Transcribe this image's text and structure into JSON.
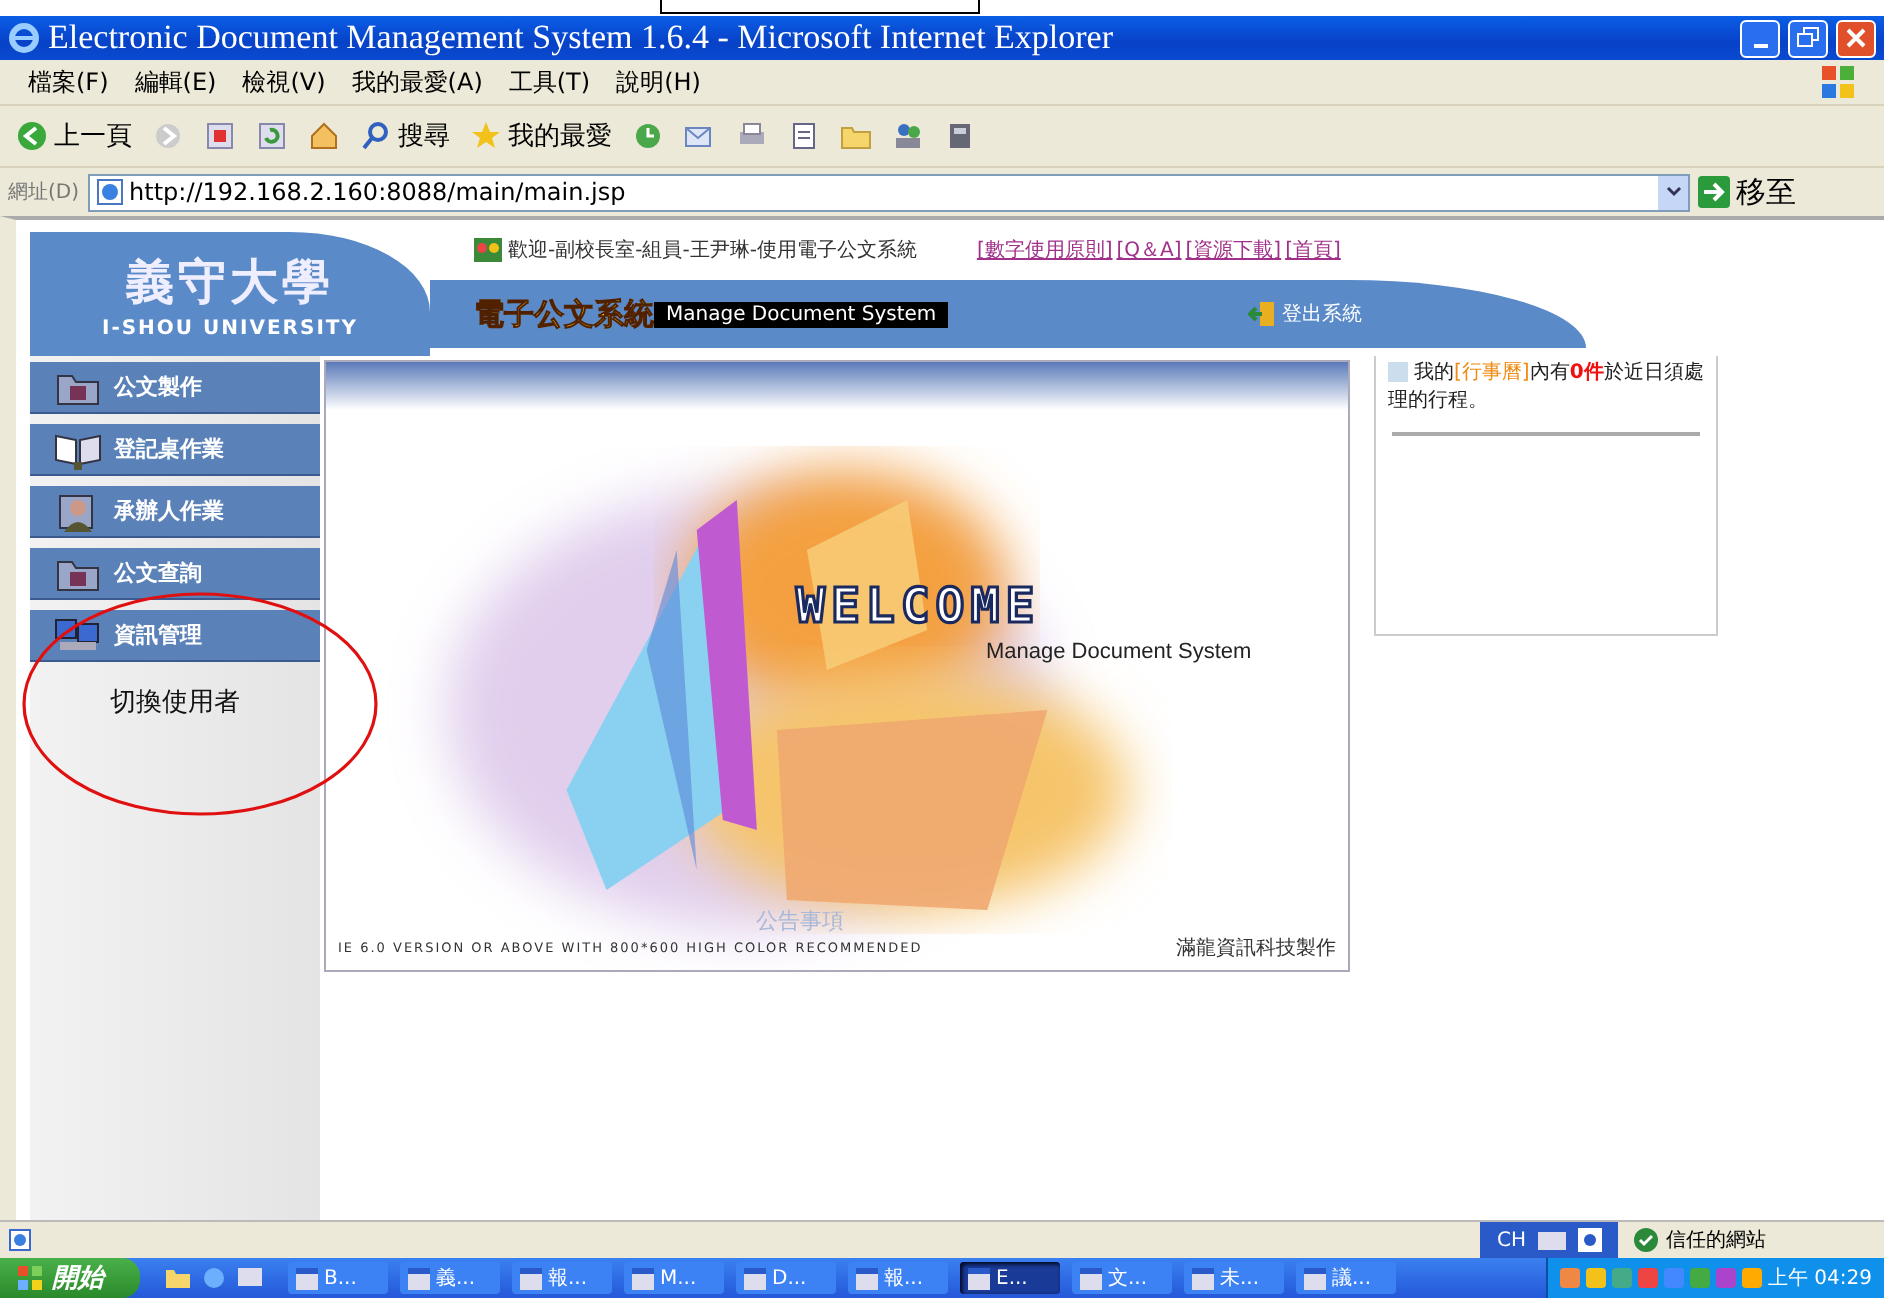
{
  "window": {
    "title": "Electronic Document Management System 1.6.4 - Microsoft Internet Explorer"
  },
  "menu": [
    "檔案(F)",
    "編輯(E)",
    "檢視(V)",
    "我的最愛(A)",
    "工具(T)",
    "說明(H)"
  ],
  "toolbar": [
    {
      "kind": "back",
      "label": "上一頁"
    },
    {
      "kind": "forward"
    },
    {
      "kind": "stop"
    },
    {
      "kind": "refresh"
    },
    {
      "kind": "home"
    },
    {
      "kind": "search",
      "label": "搜尋"
    },
    {
      "kind": "favorites",
      "label": "我的最愛"
    },
    {
      "kind": "history"
    },
    {
      "kind": "mail"
    },
    {
      "kind": "print"
    },
    {
      "kind": "edit"
    },
    {
      "kind": "folder"
    },
    {
      "kind": "messenger"
    },
    {
      "kind": "notes"
    }
  ],
  "address": {
    "label": "網址(D)",
    "value": "http://192.168.2.160:8088/main/main.jsp",
    "go": "移至"
  },
  "header": {
    "school": "義守大學",
    "school_en": "I-SHOU UNIVERSITY",
    "welcome": "歡迎-副校長室-組員-王尹琳-使用電子公文系統",
    "links": [
      "[數字使用原則]",
      "[Q＆A]",
      "[資源下載]",
      "[首頁]"
    ],
    "system_name": "電子公文系統",
    "system_en": "Manage Document System",
    "logout": "登出系統"
  },
  "sidebar": {
    "items": [
      {
        "label": "公文製作",
        "kind": "folder"
      },
      {
        "label": "登記桌作業",
        "kind": "book"
      },
      {
        "label": "承辦人作業",
        "kind": "person"
      },
      {
        "label": "公文查詢",
        "kind": "folder"
      },
      {
        "label": "資訊管理",
        "kind": "computers"
      }
    ],
    "submenu": [
      "切換使用者"
    ]
  },
  "main": {
    "welcome": "WELCOME",
    "subtitle": "Manage Document System",
    "news": "公告事項",
    "footer_note": "IE 6.0 VERSION OR ABOVE WITH 800*600 HIGH COLOR RECOMMENDED",
    "credit": "滿龍資訊科技製作"
  },
  "notice": {
    "parts": [
      {
        "kind": "plain",
        "text": "我的"
      },
      {
        "kind": "link",
        "text": "[行事曆]"
      },
      {
        "kind": "plain",
        "text": "內有"
      },
      {
        "kind": "count",
        "text": "0件"
      },
      {
        "kind": "plain",
        "text": "於近日須處理的行程。"
      }
    ]
  },
  "status_bar": {
    "ime": "CH",
    "zone": "信任的網站"
  },
  "taskbar": {
    "start": "開始",
    "items": [
      {
        "label": "B...",
        "selected": false
      },
      {
        "label": "義...",
        "selected": false
      },
      {
        "label": "報...",
        "selected": false
      },
      {
        "label": "M...",
        "selected": false
      },
      {
        "label": "D...",
        "selected": false
      },
      {
        "label": "報...",
        "selected": false
      },
      {
        "label": "E...",
        "selected": true
      },
      {
        "label": "文...",
        "selected": false
      },
      {
        "label": "未...",
        "selected": false
      },
      {
        "label": "議...",
        "selected": false
      }
    ],
    "clock": "上午 04:29"
  }
}
